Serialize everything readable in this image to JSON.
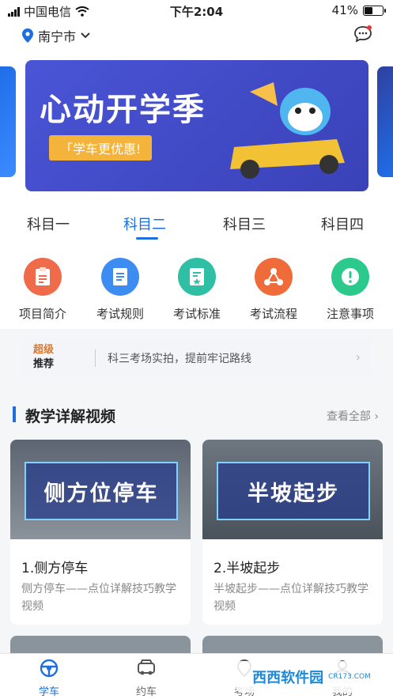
{
  "status": {
    "carrier": "中国电信",
    "time": "下午2:04",
    "battery": "41%"
  },
  "header": {
    "city": "南宁市"
  },
  "banner": {
    "headline": "心动开学季",
    "ribbon": "「学车更优惠!"
  },
  "tabs": [
    {
      "label": "科目一"
    },
    {
      "label": "科目二"
    },
    {
      "label": "科目三"
    },
    {
      "label": "科目四"
    }
  ],
  "grid": [
    {
      "label": "项目简介",
      "color": "#ef6b4a"
    },
    {
      "label": "考试规则",
      "color": "#3d8cf2"
    },
    {
      "label": "考试标准",
      "color": "#2fbfa4"
    },
    {
      "label": "考试流程",
      "color": "#f06b3a"
    },
    {
      "label": "注意事项",
      "color": "#2cc98c"
    }
  ],
  "notice": {
    "badge_top": "超级",
    "badge_bottom": "推荐",
    "text": "科三考场实拍，提前牢记路线"
  },
  "section": {
    "title": "教学详解视频",
    "more": "查看全部"
  },
  "videos": [
    {
      "thumb_text": "侧方位停车",
      "title": "1.侧方停车",
      "desc": "侧方停车——点位详解技巧教学视频"
    },
    {
      "thumb_text": "半坡起步",
      "title": "2.半坡起步",
      "desc": "半坡起步——点位详解技巧教学视频"
    }
  ],
  "tabbar": [
    {
      "label": "学车"
    },
    {
      "label": "约车"
    },
    {
      "label": "考场"
    },
    {
      "label": "我的"
    }
  ],
  "watermark": {
    "name": "西西软件园",
    "url": "CR173.COM"
  }
}
